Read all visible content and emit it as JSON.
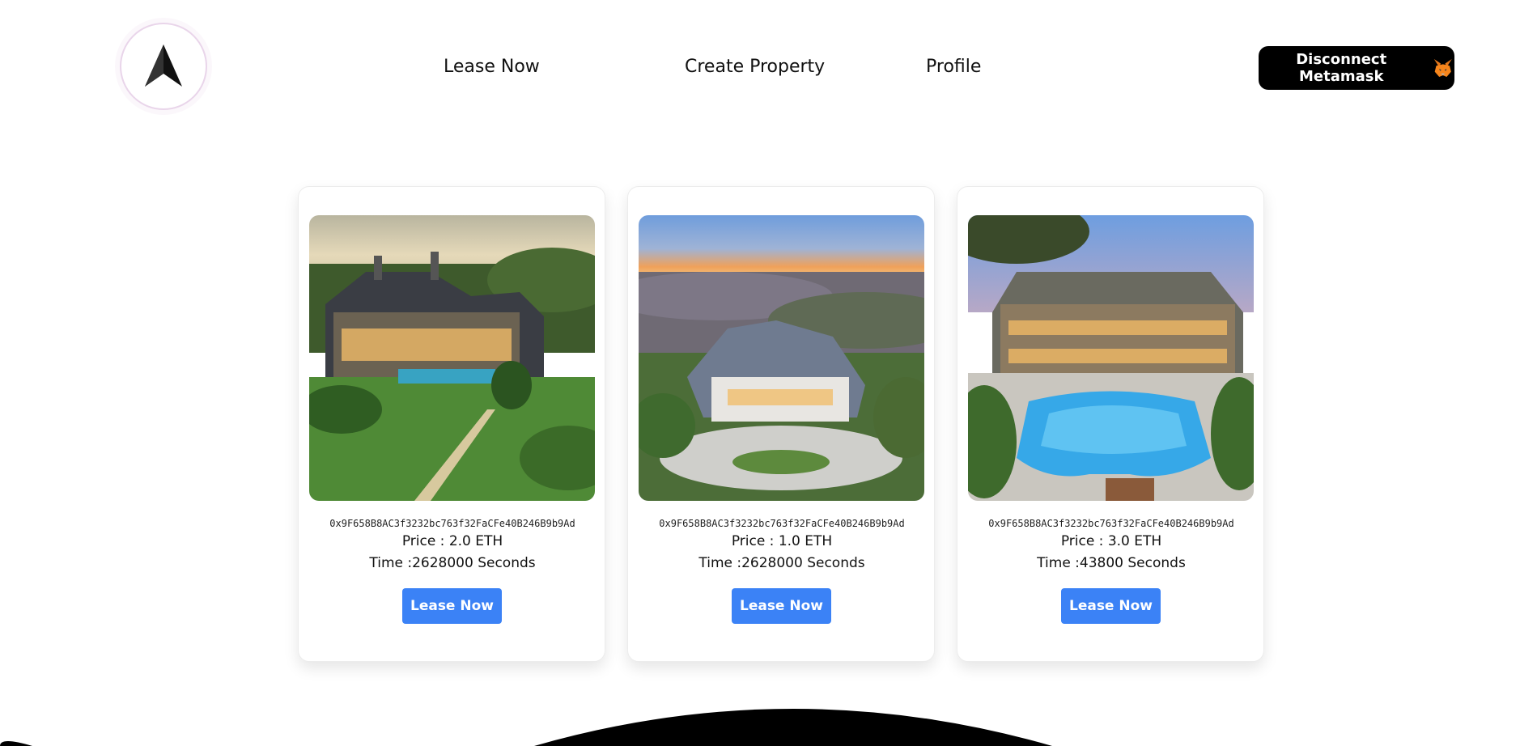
{
  "header": {
    "logo_icon": "arrow-up-icon",
    "nav": [
      {
        "label": "Lease Now"
      },
      {
        "label": "Create Property"
      },
      {
        "label": "Profile"
      }
    ],
    "wallet_button": {
      "label": "Disconnect Metamask",
      "icon": "metamask-fox-icon"
    }
  },
  "listings": [
    {
      "image": "property-photo-coastal-mansion",
      "owner": "0x9F658B8AC3f3232bc763f32FaCFe40B246B9b9Ad",
      "price": "Price : 2.0 ETH",
      "time": "Time :2628000 Seconds",
      "button": "Lease Now"
    },
    {
      "image": "property-photo-hilltop-mansion",
      "owner": "0x9F658B8AC3f3232bc763f32FaCFe40B246B9b9Ad",
      "price": "Price : 1.0 ETH",
      "time": "Time :2628000 Seconds",
      "button": "Lease Now"
    },
    {
      "image": "property-photo-pool-estate",
      "owner": "0x9F658B8AC3f3232bc763f32FaCFe40B246B9b9Ad",
      "price": "Price : 3.0 ETH",
      "time": "Time :43800 Seconds",
      "button": "Lease Now"
    }
  ],
  "colors": {
    "accent": "#3b82f6",
    "wallet_button_bg": "#000000",
    "background": "#ffffff"
  }
}
